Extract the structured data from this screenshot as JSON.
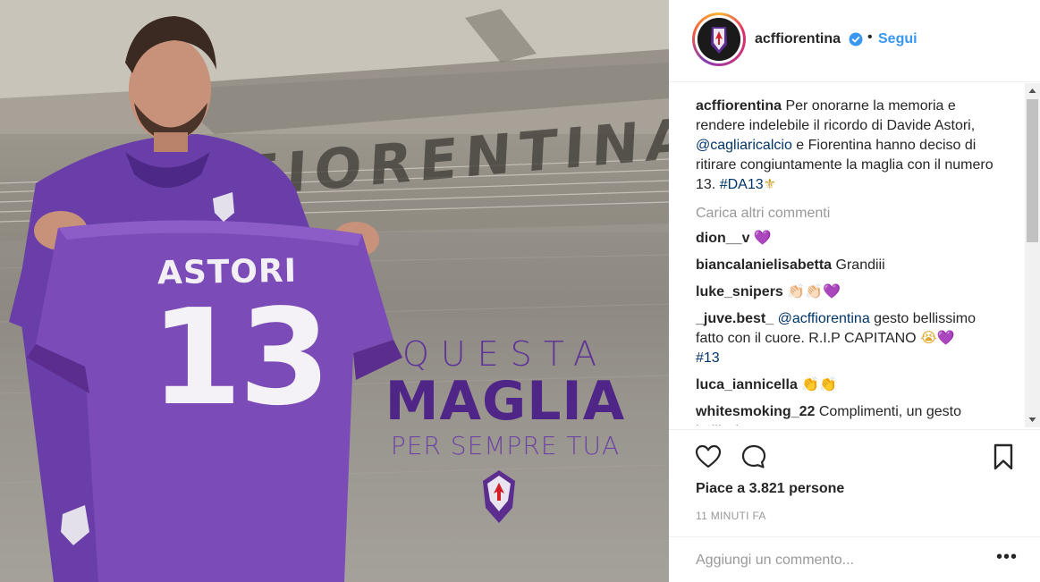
{
  "post": {
    "image_text": {
      "jersey_name": "ASTORI",
      "jersey_number": "13",
      "tagline_1": "QUESTA",
      "tagline_2": "MAGLIA",
      "tagline_3": "PER SEMPRE TUA",
      "stadium_letters": "ACFIORENTINA"
    },
    "colors": {
      "viola": "#5b2d8e",
      "jersey": "#7b4bb8",
      "link": "#3897f0"
    }
  },
  "header": {
    "username": "acffiorentina",
    "verified_icon": "verified-badge-icon",
    "separator": "•",
    "follow_label": "Segui"
  },
  "caption": {
    "username": "acffiorentina",
    "text_1": " Per onorarne la memoria e rendere indelebile il ricordo di Davide Astori, ",
    "mention": "@cagliaricalcio",
    "text_2": " e Fiorentina hanno deciso di ritirare congiuntamente la maglia con il numero 13. ",
    "hashtag": "#DA13",
    "emoji": "⚜"
  },
  "load_more_label": "Carica altri commenti",
  "comments": [
    {
      "user": "dion__v",
      "text": "",
      "emoji": "💜"
    },
    {
      "user": "biancalanielisabetta",
      "text": "Grandiii",
      "emoji": ""
    },
    {
      "user": "luke_snipers",
      "text": "",
      "emoji": "👏🏻👏🏻💜"
    },
    {
      "user": "_juve.best_",
      "mention": "@acffiorentina",
      "text": " gesto bellissimo fatto con il cuore. R.I.P CAPITANO ",
      "emoji": "😭💜",
      "hashtag": "#13"
    },
    {
      "user": "luca_iannicella",
      "text": "",
      "emoji": "👏👏"
    },
    {
      "user": "whitesmoking_22",
      "text": "Complimenti, un gesto bellissimo",
      "emoji": ""
    }
  ],
  "actions": {
    "like_icon": "heart-icon",
    "comment_icon": "comment-bubble-icon",
    "save_icon": "bookmark-icon",
    "likes_text": "Piace a 3.821 persone",
    "timestamp": "11 MINUTI FA"
  },
  "add_comment": {
    "placeholder": "Aggiungi un commento...",
    "more_label": "•••"
  }
}
